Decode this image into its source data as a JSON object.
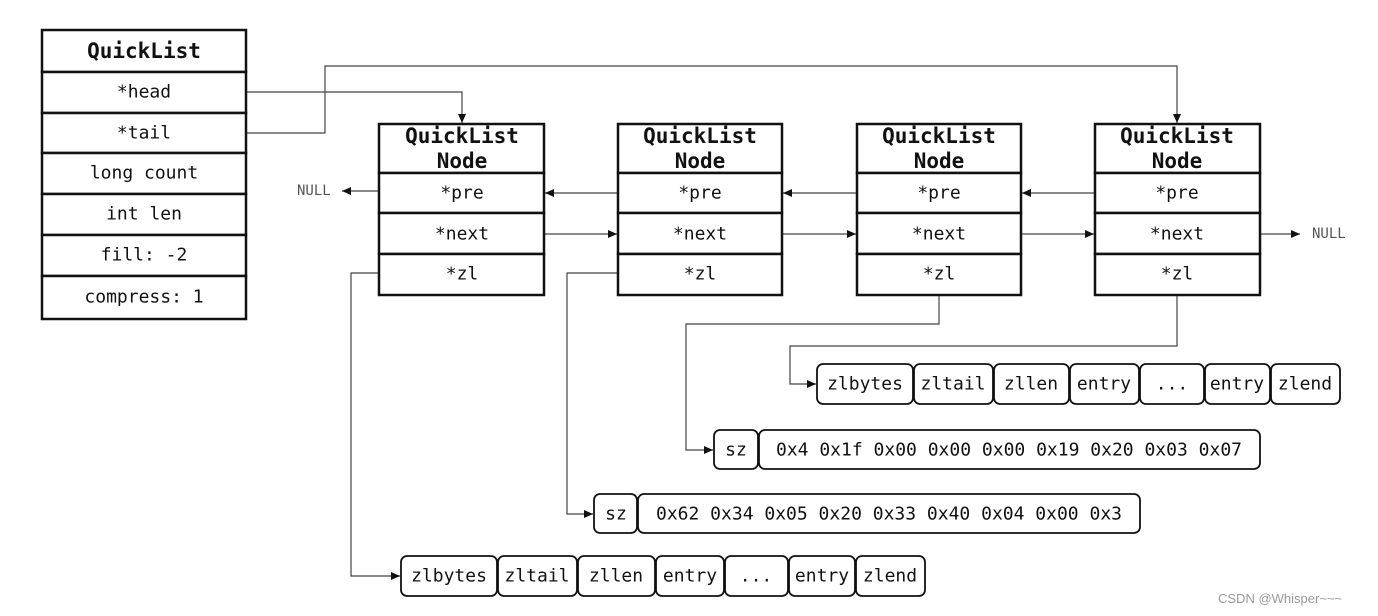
{
  "quicklist": {
    "title": "QuickList",
    "fields": [
      "*head",
      "*tail",
      "long count",
      "int len",
      "fill: -2",
      "compress: 1"
    ]
  },
  "nodes": [
    {
      "title1": "QuickList",
      "title2": "Node",
      "fields": [
        "*pre",
        "*next",
        "*zl"
      ]
    },
    {
      "title1": "QuickList",
      "title2": "Node",
      "fields": [
        "*pre",
        "*next",
        "*zl"
      ]
    },
    {
      "title1": "QuickList",
      "title2": "Node",
      "fields": [
        "*pre",
        "*next",
        "*zl"
      ]
    },
    {
      "title1": "QuickList",
      "title2": "Node",
      "fields": [
        "*pre",
        "*next",
        "*zl"
      ]
    }
  ],
  "null_label": "NULL",
  "ziplist_top": [
    "zlbytes",
    "zltail",
    "zllen",
    "entry",
    "...",
    "entry",
    "zlend"
  ],
  "ziplist_bottom": [
    "zlbytes",
    "zltail",
    "zllen",
    "entry",
    "...",
    "entry",
    "zlend"
  ],
  "compressed_1": {
    "sz": "sz",
    "bytes": "0x4 0x1f 0x00 0x00 0x00 0x19 0x20 0x03 0x07"
  },
  "compressed_2": {
    "sz": "sz",
    "bytes": "0x62 0x34 0x05 0x20 0x33 0x40 0x04 0x00 0x3"
  },
  "watermark": "CSDN @Whisper~~~",
  "colors": {
    "stroke": "#111111",
    "connector": "#444444",
    "null_text": "#555555"
  }
}
